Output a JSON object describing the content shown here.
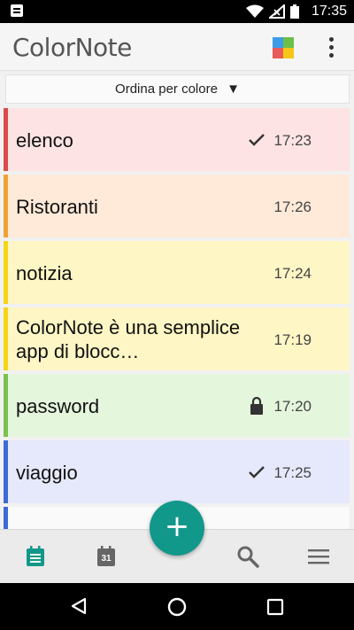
{
  "status_bar": {
    "time": "17:35"
  },
  "app_bar": {
    "title": "ColorNote"
  },
  "sort": {
    "label": "Ordina per colore",
    "arrow": "▼"
  },
  "notes": [
    {
      "title": "elenco",
      "time": "17:23",
      "status_icon": "check-icon",
      "bg": "#fde3e3",
      "accent": "#d94b4b"
    },
    {
      "title": "Ristoranti",
      "time": "17:26",
      "status_icon": "",
      "bg": "#ffe9d8",
      "accent": "#f0a235"
    },
    {
      "title": "notizia",
      "time": "17:24",
      "status_icon": "",
      "bg": "#fff6c5",
      "accent": "#f5d51b"
    },
    {
      "title": "ColorNote è una semplice app di blocc…",
      "time": "17:19",
      "status_icon": "",
      "bg": "#fff6c5",
      "accent": "#f5d51b"
    },
    {
      "title": "password",
      "time": "17:20",
      "status_icon": "lock-icon",
      "bg": "#e4f6dc",
      "accent": "#7ac24e"
    },
    {
      "title": "viaggio",
      "time": "17:25",
      "status_icon": "check-icon",
      "bg": "#e6e8fb",
      "accent": "#3d6ad6"
    }
  ],
  "fab": {
    "label": "+",
    "color": "#12988a"
  },
  "bottom_nav": {
    "items": [
      {
        "name": "notes-icon",
        "active": true
      },
      {
        "name": "calendar-icon",
        "day": "31"
      },
      {
        "name": "search-icon"
      },
      {
        "name": "menu-icon"
      }
    ],
    "active_color": "#12988a"
  }
}
